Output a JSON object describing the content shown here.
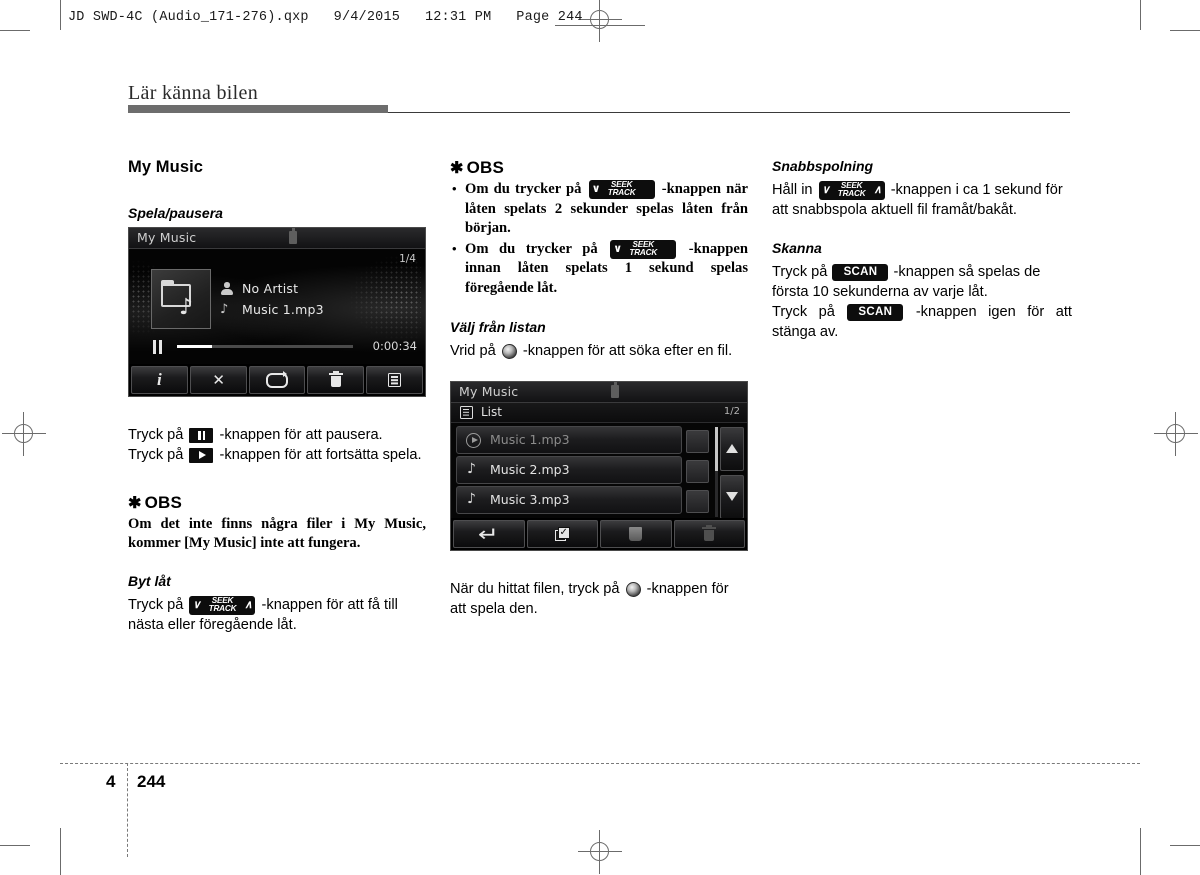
{
  "prepress": {
    "file_header": "JD SWD-4C (Audio_171-276).qxp   9/4/2015   12:31 PM   Page 244"
  },
  "running_head": {
    "title": "Lär känna bilen"
  },
  "folio": {
    "chapter": "4",
    "page": "244"
  },
  "keys": {
    "seek_track_top": "SEEK",
    "seek_track_bottom": "TRACK",
    "chevron_down": "∨",
    "chevron_up": "∧",
    "scan": "SCAN"
  },
  "col1": {
    "section_heading": "My Music",
    "play_pause": {
      "heading": "Spela/pausera",
      "line1_a": "Tryck på",
      "line1_b": "-knappen för att pausera.",
      "line2_a": "Tryck på",
      "line2_b": "-knappen för att fortsätta spela."
    },
    "note": {
      "heading": "OBS",
      "body": "Om det inte finns några filer i My Music, kommer [My Music] inte att fungera."
    },
    "change_track": {
      "heading": "Byt låt",
      "text_a": "Tryck på",
      "text_b": "-knappen för att få till nästa eller föregående låt."
    },
    "player_screen": {
      "title": "My Music",
      "track_count": "1/4",
      "artist": "No Artist",
      "track": "Music 1.mp3",
      "elapsed": "0:00:34",
      "progress_percent": 20,
      "buttons": [
        "info-button",
        "shuffle-button",
        "repeat-button",
        "delete-button",
        "list-button"
      ]
    }
  },
  "col2": {
    "note": {
      "heading": "OBS",
      "bullet1_a": "Om du trycker på",
      "bullet1_b": "-knappen när låten spelats 2 sekunder spelas låten från början.",
      "bullet2_a": "Om du trycker på",
      "bullet2_b": "-knappen innan låten spelats 1 sekund spelas föregående låt."
    },
    "select_from_list": {
      "heading": "Välj från listan",
      "text_a": "Vrid på",
      "text_b": "-knappen för att söka efter en fil."
    },
    "after_list": {
      "text_a": "När du hittat filen, tryck på",
      "text_b": "-knappen för att spela den."
    },
    "list_screen": {
      "title": "My Music",
      "subtitle": "List",
      "page_indicator": "1/2",
      "rows": [
        {
          "name": "Music 1.mp3",
          "state": "playing"
        },
        {
          "name": "Music 2.mp3",
          "state": "idle"
        },
        {
          "name": "Music 3.mp3",
          "state": "idle"
        }
      ],
      "scroll_up": "scroll-up-button",
      "scroll_down": "scroll-down-button",
      "buttons": [
        "back-button",
        "select-all-button",
        "page-button",
        "delete-button"
      ]
    }
  },
  "col3": {
    "fast_forward": {
      "heading": "Snabbspolning",
      "text_a": "Håll in",
      "text_b": "-knappen i ca 1 sekund för att snabbspola aktuell fil framåt/bakåt."
    },
    "scan": {
      "heading": "Skanna",
      "line1_a": "Tryck på",
      "line1_b": "-knappen så spelas de första 10 sekunderna av varje låt.",
      "line2_a": "Tryck på",
      "line2_b": "-knappen igen för att stänga av."
    }
  }
}
